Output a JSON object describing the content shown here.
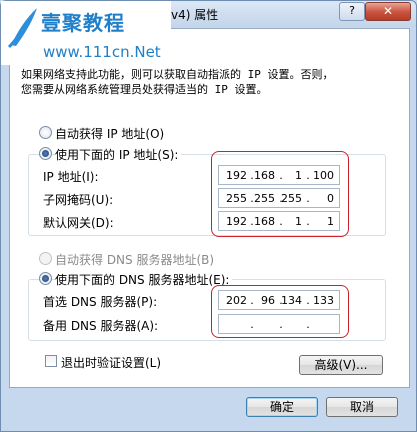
{
  "window": {
    "title": "v4) 属性",
    "help_label": "?",
    "close_label": "✕"
  },
  "watermark": {
    "name": "壹聚教程",
    "url": "www.111cn.Net"
  },
  "intro": {
    "line1": "如果网络支持此功能，则可以获取自动指派的 IP 设置。否则，",
    "line2": "您需要从网络系统管理员处获得适当的 IP 设置。"
  },
  "ip": {
    "auto_label": "自动获得 IP 地址(O)",
    "manual_label": "使用下面的 IP 地址(S):",
    "address_label": "IP 地址(I):",
    "mask_label": "子网掩码(U):",
    "gateway_label": "默认网关(D):",
    "address": [
      "192",
      "168",
      "1",
      "100"
    ],
    "mask": [
      "255",
      "255",
      "255",
      "0"
    ],
    "gateway": [
      "192",
      "168",
      "1",
      "1"
    ]
  },
  "dns": {
    "auto_label": "自动获得 DNS 服务器地址(B)",
    "manual_label": "使用下面的 DNS 服务器地址(E):",
    "preferred_label": "首选 DNS 服务器(P):",
    "alternate_label": "备用 DNS 服务器(A):",
    "preferred": [
      "202",
      "96",
      "134",
      "133"
    ],
    "alternate": [
      "",
      "",
      "",
      ""
    ]
  },
  "footer": {
    "validate_label": "退出时验证设置(L)",
    "advanced_label": "高级(V)...",
    "ok_label": "确定",
    "cancel_label": "取消"
  },
  "colors": {
    "highlight": "#c8222c",
    "titlebar": "#c3d5ea",
    "watermark": "#1f7fc9"
  }
}
